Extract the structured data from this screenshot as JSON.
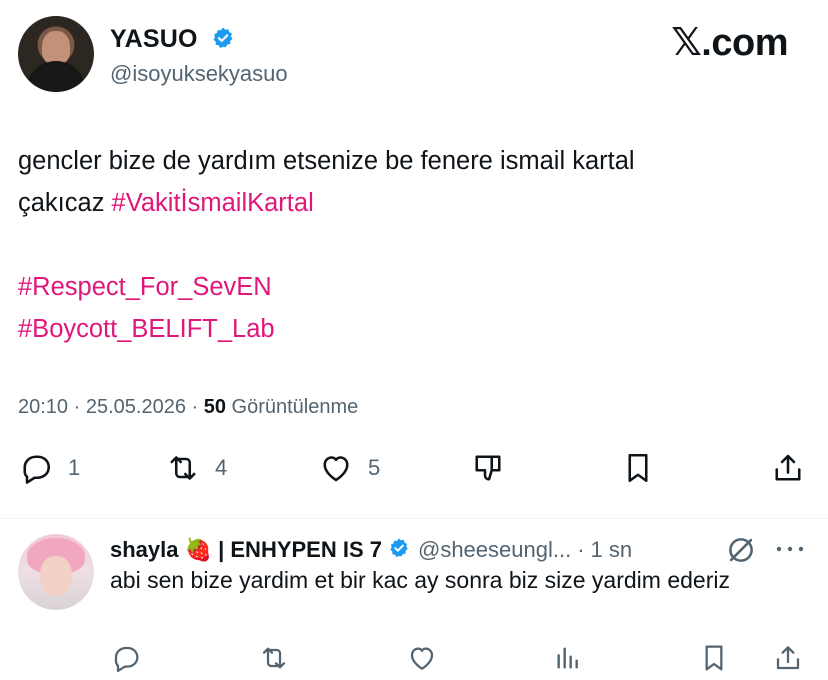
{
  "brand": {
    "label": "𝕏.com"
  },
  "author": {
    "display_name": "YASUO",
    "handle": "@isoyuksekyasuo",
    "verified_color": "#1d9bf0"
  },
  "tweet": {
    "text_line1": "gencler bize de yardım etsenize be fenere ismail kartal",
    "text_line2_prefix": "çakıcaz ",
    "hashtag1": "#VakitİsmailKartal",
    "hashtag2": "#Respect_For_SevEN",
    "hashtag3": "#Boycott_BELIFT_Lab",
    "hashtag_color": "#e0177b",
    "time": "20:10",
    "sep1": " · ",
    "date": "25.05.2026",
    "sep2": " · ",
    "views_count": "50",
    "views_label": " Görüntülenme"
  },
  "actions": {
    "reply_icon": "reply-icon",
    "reply_count": "1",
    "retweet_icon": "retweet-icon",
    "retweet_count": "4",
    "like_icon": "heart-icon",
    "like_count": "5",
    "dislike_icon": "thumbs-down-icon",
    "bookmark_icon": "bookmark-icon",
    "share_icon": "share-icon"
  },
  "reply": {
    "name": "shayla 🍓 | ENHYPEN IS 7",
    "handle": "@sheeseungl...",
    "separator": "·",
    "time": "1 sn",
    "text": "abi sen bize yardim et bir kac ay sonra biz size yardim ederiz"
  }
}
